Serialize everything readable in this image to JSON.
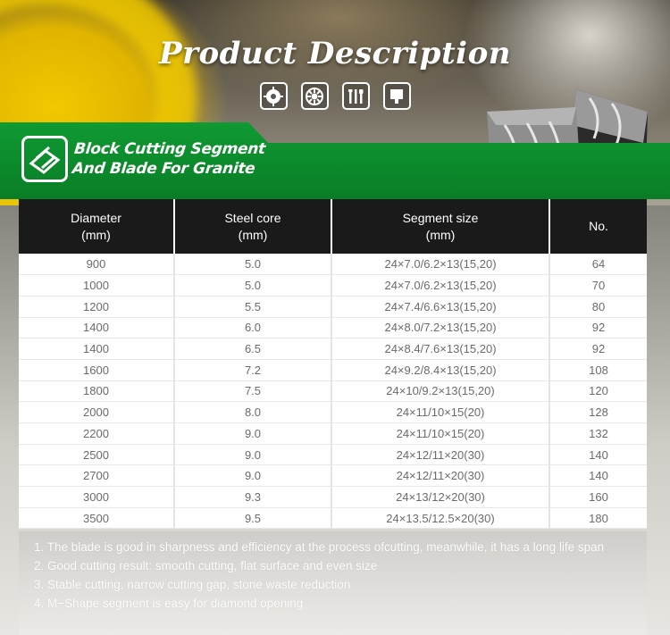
{
  "header": {
    "title": "Product Description",
    "icons": [
      "saw-blade-icon",
      "segmented-blade-icon",
      "tools-icon",
      "stone-block-icon"
    ]
  },
  "banner": {
    "line1": "Block Cutting Segment",
    "line2": "And Blade For Granite",
    "logo_icon": "diamond-segment-icon",
    "accent_color": "#0f9a32"
  },
  "table": {
    "headers": [
      {
        "line1": "Diameter",
        "line2": "(mm)"
      },
      {
        "line1": "Steel core",
        "line2": "(mm)"
      },
      {
        "line1": "Segment size",
        "line2": "(mm)"
      },
      {
        "line1": "No.",
        "line2": ""
      }
    ],
    "rows": [
      [
        "900",
        "5.0",
        "24×7.0/6.2×13(15,20)",
        "64"
      ],
      [
        "1000",
        "5.0",
        "24×7.0/6.2×13(15,20)",
        "70"
      ],
      [
        "1200",
        "5.5",
        "24×7.4/6.6×13(15,20)",
        "80"
      ],
      [
        "1400",
        "6.0",
        "24×8.0/7.2×13(15,20)",
        "92"
      ],
      [
        "1400",
        "6.5",
        "24×8.4/7.6×13(15,20)",
        "92"
      ],
      [
        "1600",
        "7.2",
        "24×9.2/8.4×13(15,20)",
        "108"
      ],
      [
        "1800",
        "7.5",
        "24×10/9.2×13(15,20)",
        "120"
      ],
      [
        "2000",
        "8.0",
        "24×11/10×15(20)",
        "128"
      ],
      [
        "2200",
        "9.0",
        "24×11/10×15(20)",
        "132"
      ],
      [
        "2500",
        "9.0",
        "24×12/11×20(30)",
        "140"
      ],
      [
        "2700",
        "9.0",
        "24×12/11×20(30)",
        "140"
      ],
      [
        "3000",
        "9.3",
        "24×13/12×20(30)",
        "160"
      ],
      [
        "3500",
        "9.5",
        "24×13.5/12.5×20(30)",
        "180"
      ]
    ]
  },
  "notes": [
    "1. The blade is good in sharpness and efficiency at the process ofcutting, meanwhile, it has a long life span",
    "2. Good cutting result: smooth cutting, flat surface and even size",
    "3. Stable cutting, narrow cutting gap, stone waste reduction",
    "4. M−Shape segment is easy for diamond opening"
  ]
}
